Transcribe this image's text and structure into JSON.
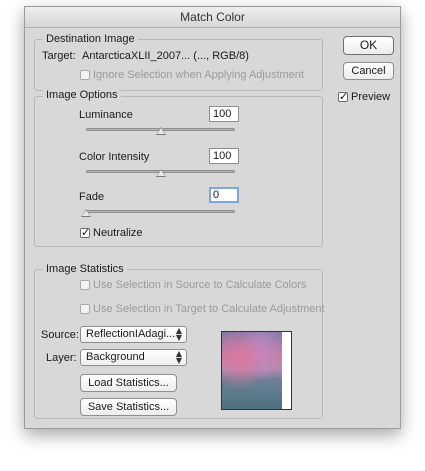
{
  "window": {
    "title": "Match Color"
  },
  "destination": {
    "title": "Destination Image",
    "target_label": "Target:",
    "target_value": "AntarcticaXLII_2007... (..., RGB/8)",
    "ignore_selection": {
      "label": "Ignore Selection when Applying Adjustment",
      "checked": false,
      "enabled": false
    }
  },
  "options": {
    "title": "Image Options",
    "luminance": {
      "label": "Luminance",
      "value": "100",
      "level": 0.5
    },
    "color_intensity": {
      "label": "Color Intensity",
      "value": "100",
      "level": 0.5
    },
    "fade": {
      "label": "Fade",
      "value": "0",
      "level": 0
    },
    "neutralize": {
      "label": "Neutralize",
      "checked": true
    }
  },
  "statistics": {
    "title": "Image Statistics",
    "use_source": {
      "label": "Use Selection in Source to Calculate Colors",
      "checked": false,
      "enabled": false
    },
    "use_target": {
      "label": "Use Selection in Target to Calculate Adjustment",
      "checked": false,
      "enabled": false
    },
    "source": {
      "label": "Source:",
      "value": "ReflectionIAdagi..."
    },
    "layer": {
      "label": "Layer:",
      "value": "Background"
    },
    "load_button": "Load Statistics...",
    "save_button": "Save Statistics..."
  },
  "buttons": {
    "ok": "OK",
    "cancel": "Cancel"
  },
  "preview": {
    "label": "Preview",
    "checked": true
  },
  "icons": {
    "dropdown": "updown-arrows-icon",
    "checkmark": "checkmark-icon"
  }
}
